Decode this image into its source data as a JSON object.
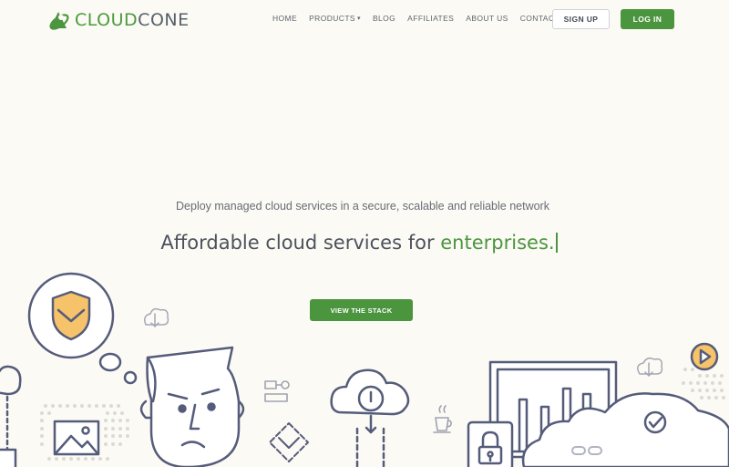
{
  "header": {
    "logo": {
      "part1": "CLOUD",
      "part2": "CONE"
    },
    "nav": [
      {
        "label": "HOME"
      },
      {
        "label": "PRODUCTS",
        "caret": "▾"
      },
      {
        "label": "BLOG"
      },
      {
        "label": "AFFILIATES"
      },
      {
        "label": "ABOUT US"
      },
      {
        "label": "CONTACT"
      }
    ],
    "signup_label": "SIGN UP",
    "login_label": "LOG IN"
  },
  "hero": {
    "tagline": "Deploy managed cloud services in a secure, scalable and reliable network",
    "headline_prefix": "Affordable cloud services for ",
    "headline_accent": "enterprises.",
    "cta_label": "VIEW THE STACK"
  },
  "colors": {
    "brand_green": "#4b953f",
    "background": "#fcfaf4",
    "outline": "#555c7a",
    "accent_orange": "#f6c36a"
  },
  "icons": [
    "logo-mark-icon",
    "chevron-down-icon",
    "shield-icon",
    "cloud-download-icon",
    "picture-icon",
    "flowchart-icon",
    "diamond-arrow-icon",
    "cloud-power-icon",
    "coffee-cup-icon",
    "padlock-icon",
    "bar-chart-icon",
    "check-circle-icon",
    "chain-link-icon",
    "play-icon"
  ]
}
